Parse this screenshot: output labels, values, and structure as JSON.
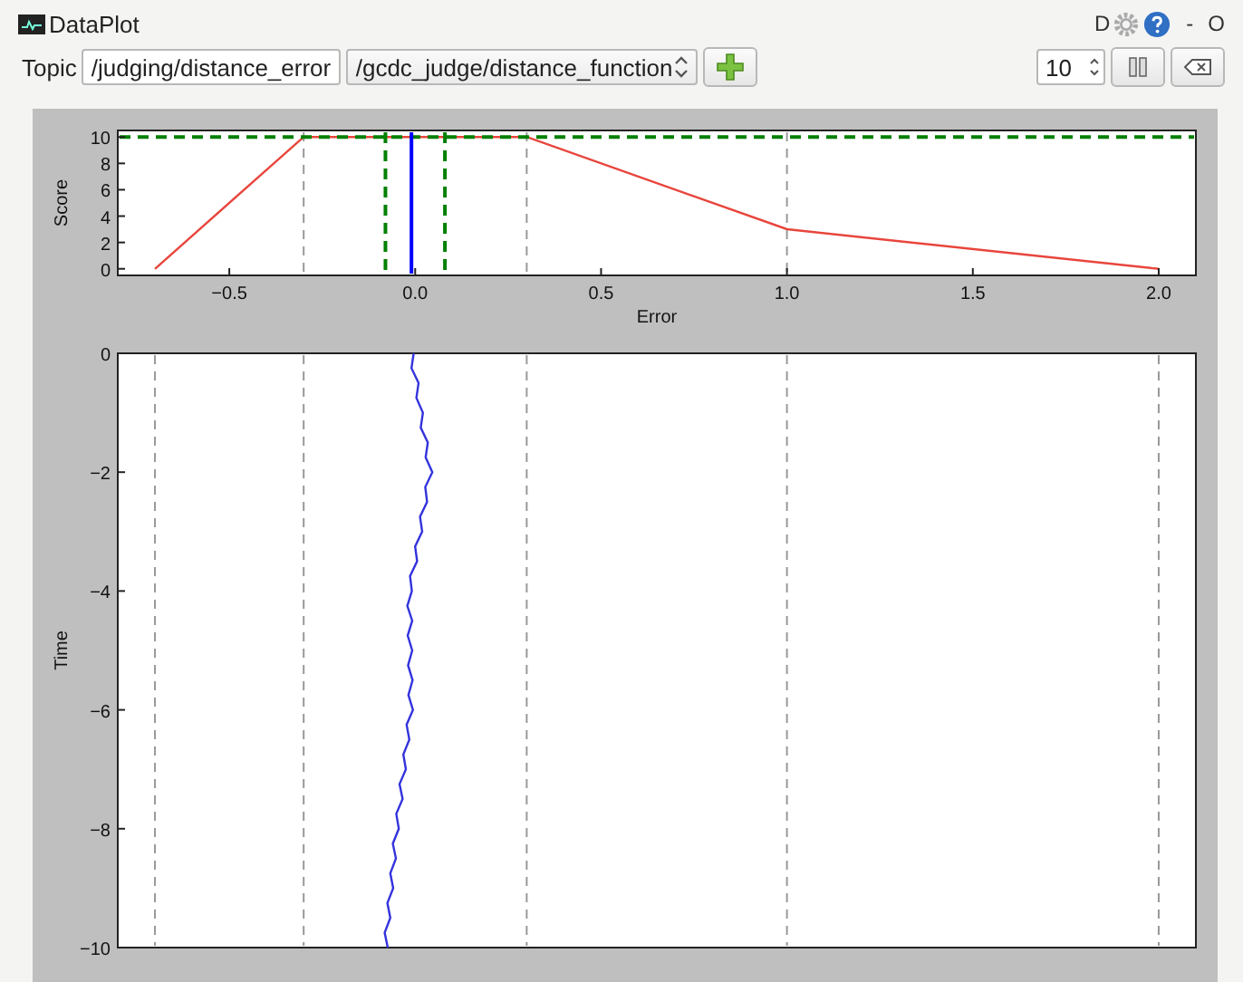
{
  "window": {
    "title": "DataPlot",
    "title_buttons": [
      "D",
      "-",
      "O"
    ]
  },
  "toolbar": {
    "topic_label": "Topic",
    "topic_value": "/judging/distance_error",
    "function_value": "/gcdc_judge/distance_function",
    "buffer_value": "10"
  },
  "charts": [
    {
      "chart_data": {
        "type": "line",
        "xlabel": "Error",
        "ylabel": "Score",
        "x": [
          -0.7,
          -0.3,
          0.3,
          1.0,
          2.0
        ],
        "series": [
          {
            "color": "#e8453c",
            "values": [
              0,
              10,
              10,
              3,
              0
            ]
          }
        ],
        "xlim": [
          -0.8,
          2.1
        ],
        "ylim": [
          -0.5,
          10.5
        ],
        "xticks": [
          {
            "value": -0.5,
            "label": "−0.5"
          },
          {
            "value": 0,
            "label": "0.0"
          },
          {
            "value": 0.5,
            "label": "0.5"
          },
          {
            "value": 1,
            "label": "1.0"
          },
          {
            "value": 1.5,
            "label": "1.5"
          },
          {
            "value": 2,
            "label": "2.0"
          }
        ],
        "yticks": [
          0,
          2,
          4,
          6,
          8,
          10
        ],
        "ref_lines": [
          {
            "axis": "x",
            "value": -0.3,
            "color": "#999999"
          },
          {
            "axis": "x",
            "value": 0.3,
            "color": "#999999"
          },
          {
            "axis": "x",
            "value": 1.0,
            "color": "#999999"
          },
          {
            "axis": "y",
            "value": 10,
            "color": "#008000"
          },
          {
            "axis": "x",
            "value": -0.08,
            "color": "#008000"
          },
          {
            "axis": "x",
            "value": 0.08,
            "color": "#008000"
          },
          {
            "axis": "x",
            "value": -0.01,
            "color": "#0000ff"
          }
        ]
      }
    },
    {
      "chart_data": {
        "type": "line",
        "orientation": "horizontal",
        "ylabel": "Time",
        "x": [
          0,
          -0.25,
          -0.5,
          -0.75,
          -1,
          -1.25,
          -1.5,
          -1.75,
          -2,
          -2.25,
          -2.5,
          -2.75,
          -3,
          -3.25,
          -3.5,
          -3.75,
          -4,
          -4.25,
          -4.5,
          -4.75,
          -5,
          -5.25,
          -5.5,
          -5.75,
          -6,
          -6.25,
          -6.5,
          -6.75,
          -7,
          -7.25,
          -7.5,
          -7.75,
          -8,
          -8.25,
          -8.5,
          -8.75,
          -9,
          -9.25,
          -9.5,
          -9.75,
          -10
        ],
        "series": [
          {
            "color": "#3333dd",
            "values": [
              -0.004,
              -0.01,
              0.009,
              0.003,
              0.021,
              0.015,
              0.034,
              0.028,
              0.046,
              0.027,
              0.032,
              0.013,
              0.019,
              0.0,
              0.005,
              -0.014,
              -0.009,
              -0.021,
              -0.008,
              -0.02,
              -0.008,
              -0.019,
              -0.007,
              -0.018,
              -0.006,
              -0.023,
              -0.016,
              -0.032,
              -0.025,
              -0.042,
              -0.034,
              -0.051,
              -0.044,
              -0.06,
              -0.052,
              -0.067,
              -0.059,
              -0.075,
              -0.067,
              -0.082,
              -0.074
            ]
          }
        ],
        "xlim": [
          -0.8,
          2.1
        ],
        "ylim": [
          -10,
          0
        ],
        "yticks": [
          0,
          -2,
          -4,
          -6,
          -8,
          -10
        ],
        "ref_lines": [
          {
            "axis": "x",
            "value": -0.7,
            "color": "#999999"
          },
          {
            "axis": "x",
            "value": -0.3,
            "color": "#999999"
          },
          {
            "axis": "x",
            "value": 0.3,
            "color": "#999999"
          },
          {
            "axis": "x",
            "value": 1.0,
            "color": "#999999"
          },
          {
            "axis": "x",
            "value": 2.0,
            "color": "#999999"
          }
        ]
      }
    }
  ]
}
